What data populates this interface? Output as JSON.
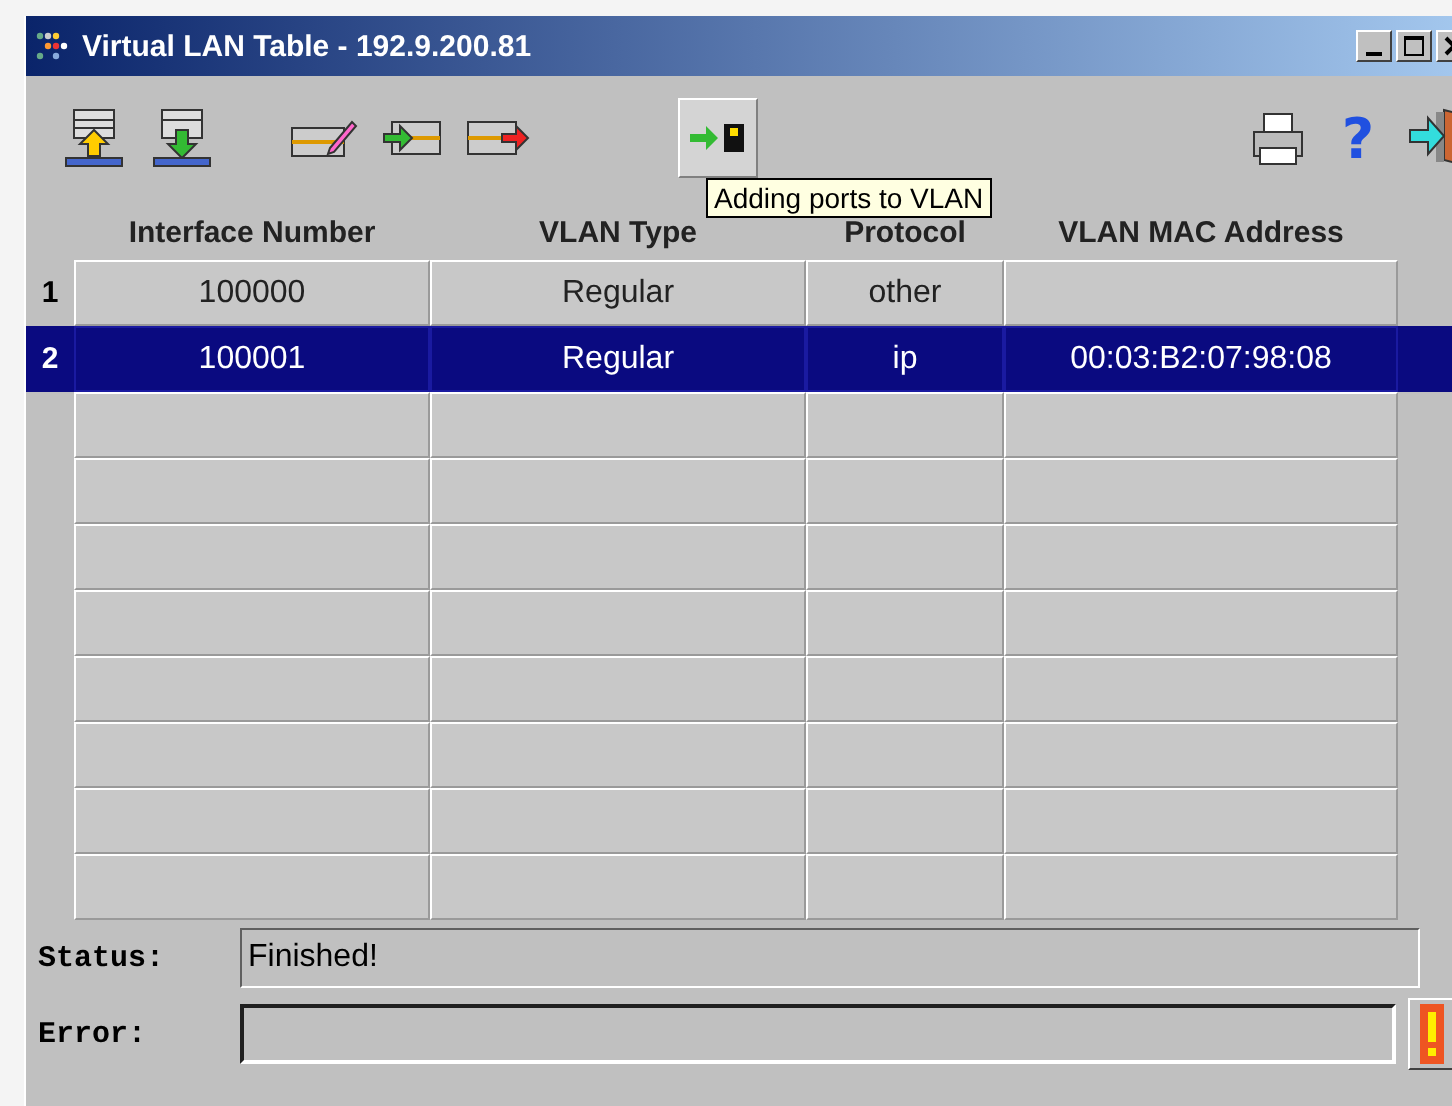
{
  "window": {
    "title": "Virtual LAN Table - 192.9.200.81"
  },
  "toolbar": {
    "help_label": "?",
    "tooltip": "Adding ports to VLAN"
  },
  "table": {
    "columns": [
      "Interface Number",
      "VLAN Type",
      "Protocol",
      "VLAN MAC Address"
    ],
    "rows": [
      {
        "number": "1",
        "interface": "100000",
        "type": "Regular",
        "protocol": "other",
        "selected": false
      },
      {
        "number": "2",
        "interface": "100001",
        "type": "Regular",
        "protocol": "ip",
        "mac": "00:03:B2:07:98:08",
        "selected": true
      }
    ]
  },
  "status": {
    "label": "Status:",
    "value": "Finished!"
  },
  "error": {
    "label": "Error:"
  }
}
